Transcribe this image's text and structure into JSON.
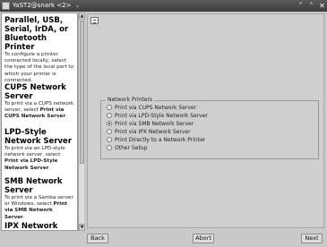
{
  "window": {
    "title": "YaST2@snark <2>",
    "title_caret": "⌄",
    "minimize_glyph": "˅",
    "maximize_glyph": "˄",
    "close_glyph": "✕"
  },
  "help": {
    "sections": [
      {
        "heading": "Parallel, USB, Serial, IrDA, or Bluetooth Printer",
        "text": "To configure a printer connected locally, select the type of the local port to which your printer is connected."
      },
      {
        "heading": "CUPS Network Server",
        "text_prefix": "To print via a CUPS network server, select ",
        "text_bold": "Print via CUPS Network Server",
        "text_suffix": "."
      },
      {
        "heading": "LPD-Style Network Server",
        "text_prefix": "To print via an LPD-style network server, select ",
        "text_bold": "Print via LPD-Style Network Server",
        "text_suffix": "."
      },
      {
        "heading": "SMB Network Server",
        "text_prefix": "To print via a Samba server or Windows, select ",
        "text_bold": "Print via SMB Network Server",
        "text_suffix": "."
      },
      {
        "heading": "IPX Network Server"
      }
    ]
  },
  "scrollbar": {
    "up_glyph": "▲",
    "down_glyph": "▼"
  },
  "network_printers": {
    "legend": "Network Printers",
    "options": [
      {
        "label": "Print via CUPS Network Server",
        "checked": false
      },
      {
        "label": "Print via LPD-Style Network Server",
        "checked": false
      },
      {
        "label": "Print via SMB Network Server",
        "checked": true
      },
      {
        "label": "Print via IPX Network Server",
        "checked": false
      },
      {
        "label": "Print Directly to a Network Printer",
        "checked": false
      },
      {
        "label": "Other Setup",
        "checked": false
      }
    ]
  },
  "buttons": {
    "back": "Back",
    "abort": "Abort",
    "next": "Next"
  }
}
